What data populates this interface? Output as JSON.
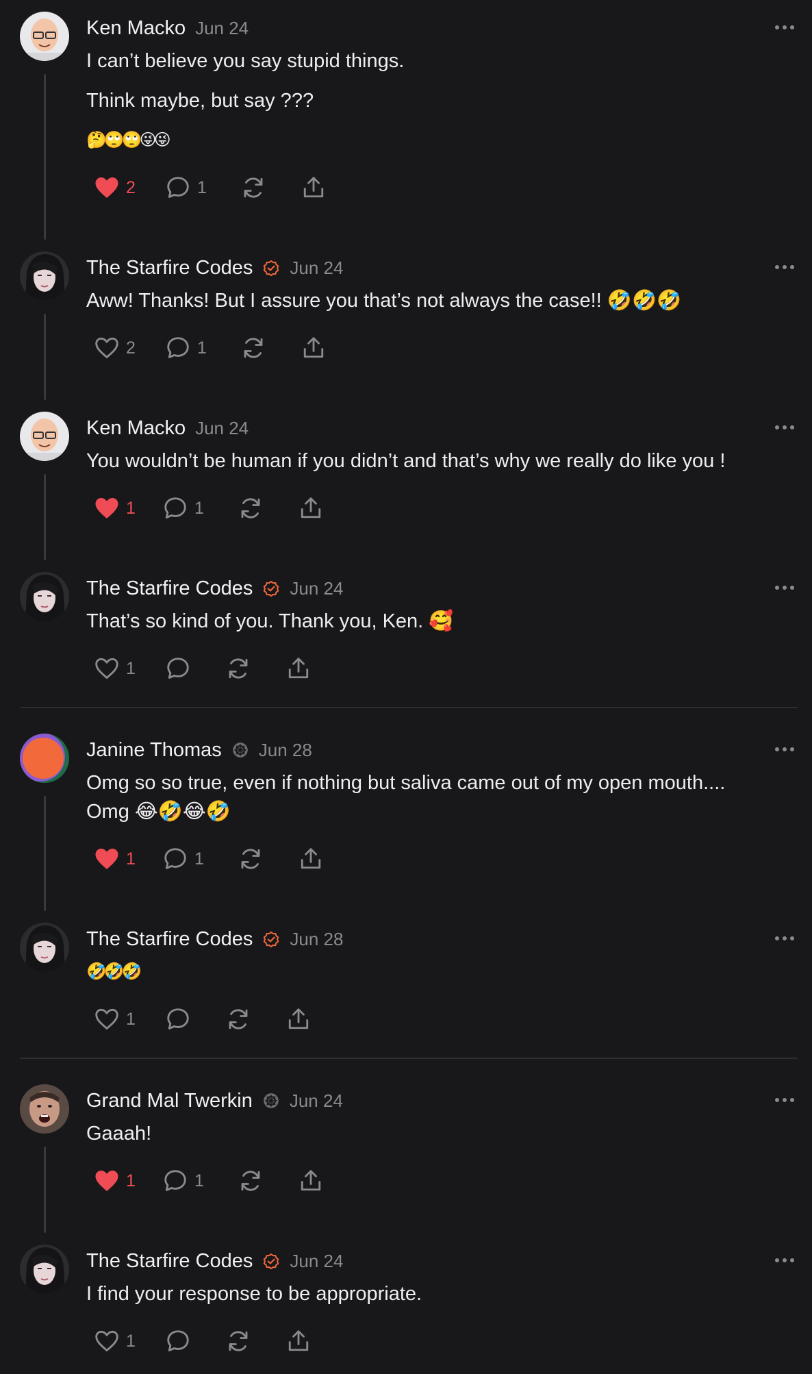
{
  "posts": [
    {
      "name": "Ken Macko",
      "date": "Jun 24",
      "lines": [
        "I can’t believe you say stupid things.",
        "Think maybe, but say ???",
        "🤔🙄🙄😜😜"
      ],
      "likes": "2",
      "liked": true,
      "replies": "1"
    },
    {
      "name": "The Starfire Codes",
      "verified": true,
      "date": "Jun 24",
      "lines": [
        "Aww! Thanks! But I assure you that’s not always the case!! 🤣🤣🤣"
      ],
      "likes": "2",
      "liked": false,
      "replies": "1"
    },
    {
      "name": "Ken Macko",
      "date": "Jun 24",
      "lines": [
        "You wouldn’t be human if you didn’t and that’s why we really do like you !"
      ],
      "likes": "1",
      "liked": true,
      "replies": "1"
    },
    {
      "name": "The Starfire Codes",
      "verified": true,
      "date": "Jun 24",
      "lines": [
        "That’s so kind of you. Thank you, Ken. 🥰"
      ],
      "likes": "1",
      "liked": false,
      "replies": ""
    },
    {
      "name": "Janine Thomas",
      "date": "Jun 28",
      "lines": [
        "Omg so so true, even if nothing but saliva came out of my open mouth....\nOmg 😂🤣😂🤣"
      ],
      "likes": "1",
      "liked": true,
      "replies": "1"
    },
    {
      "name": "The Starfire Codes",
      "verified": true,
      "date": "Jun 28",
      "lines": [
        "🤣🤣🤣"
      ],
      "likes": "1",
      "liked": false,
      "replies": ""
    },
    {
      "name": "Grand Mal Twerkin",
      "date": "Jun 24",
      "lines": [
        "Gaaah!"
      ],
      "likes": "1",
      "liked": true,
      "replies": "1"
    },
    {
      "name": "The Starfire Codes",
      "verified": true,
      "date": "Jun 24",
      "lines": [
        "I find your response to be appropriate."
      ],
      "likes": "1",
      "liked": false,
      "replies": ""
    }
  ],
  "colors": {
    "background": "#18181a",
    "liked": "#ef4c55",
    "verified": "#f0673b",
    "muted": "#8a8a90"
  },
  "icons": [
    "heart-icon",
    "comment-icon",
    "repost-icon",
    "share-icon",
    "more-icon",
    "verified-badge-icon",
    "threads-badge-icon"
  ]
}
